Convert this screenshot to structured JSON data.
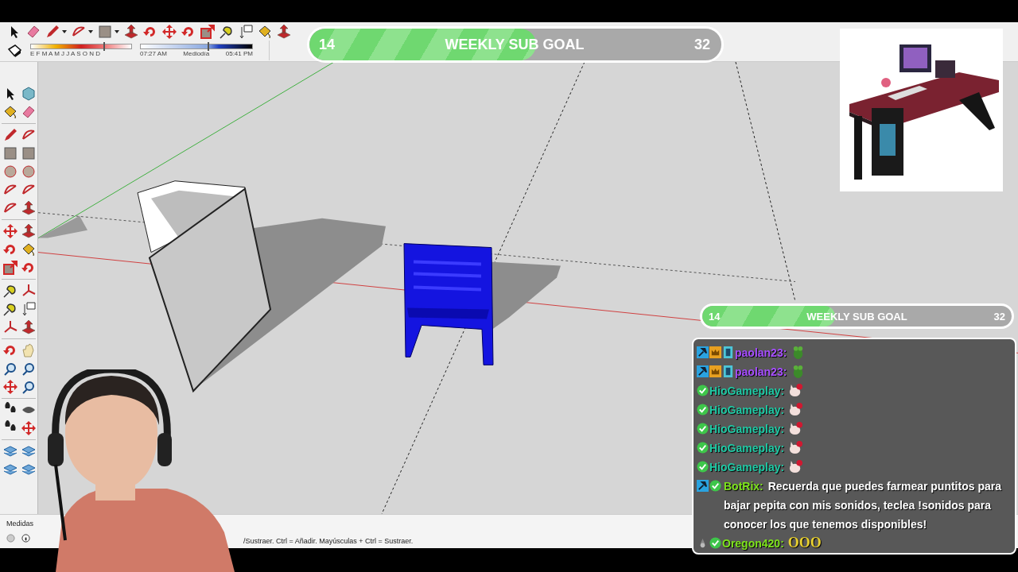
{
  "toolbar": {
    "date_slider": {
      "level": 0.72
    },
    "months": "E F M A M J J A S O N D",
    "time_slider": {
      "level": 0.6
    },
    "time_start": "07:27 AM",
    "time_mid": "Mediodía",
    "time_end": "05:41 PM"
  },
  "goals": [
    {
      "start": "14",
      "title": "WEEKLY SUB GOAL",
      "end": "32",
      "level": 0.55
    },
    {
      "start": "14",
      "title": "WEEKLY SUB GOAL",
      "end": "32",
      "level": 0.43
    }
  ],
  "chat": [
    {
      "kind": "subscriber",
      "user": "paolan23:",
      "color": "#a64dff"
    },
    {
      "kind": "subscriber",
      "user": "paolan23:",
      "color": "#a64dff"
    },
    {
      "kind": "verified",
      "user": "HioGameplay:",
      "color": "#1fc9a4"
    },
    {
      "kind": "verified",
      "user": "HioGameplay:",
      "color": "#1fc9a4"
    },
    {
      "kind": "verified",
      "user": "HioGameplay:",
      "color": "#1fc9a4"
    },
    {
      "kind": "verified",
      "user": "HioGameplay:",
      "color": "#1fc9a4"
    },
    {
      "kind": "verified",
      "user": "HioGameplay:",
      "color": "#1fc9a4"
    },
    {
      "kind": "bot",
      "user": "BotRix:",
      "color": "#7de31c",
      "text": "Recuerda que puedes farmear puntitos para bajar pepita con mis sonidos, teclea !sonidos para conocer los que tenemos disponibles!"
    },
    {
      "kind": "cheer",
      "user": "Oregon420:",
      "color": "#7de31c",
      "emote_text": "OOO"
    }
  ],
  "status_bar": {
    "label": "Medidas",
    "hint": "/Sustraer. Ctrl = Añadir. Mayúsculas + Ctrl = Sustraer."
  }
}
